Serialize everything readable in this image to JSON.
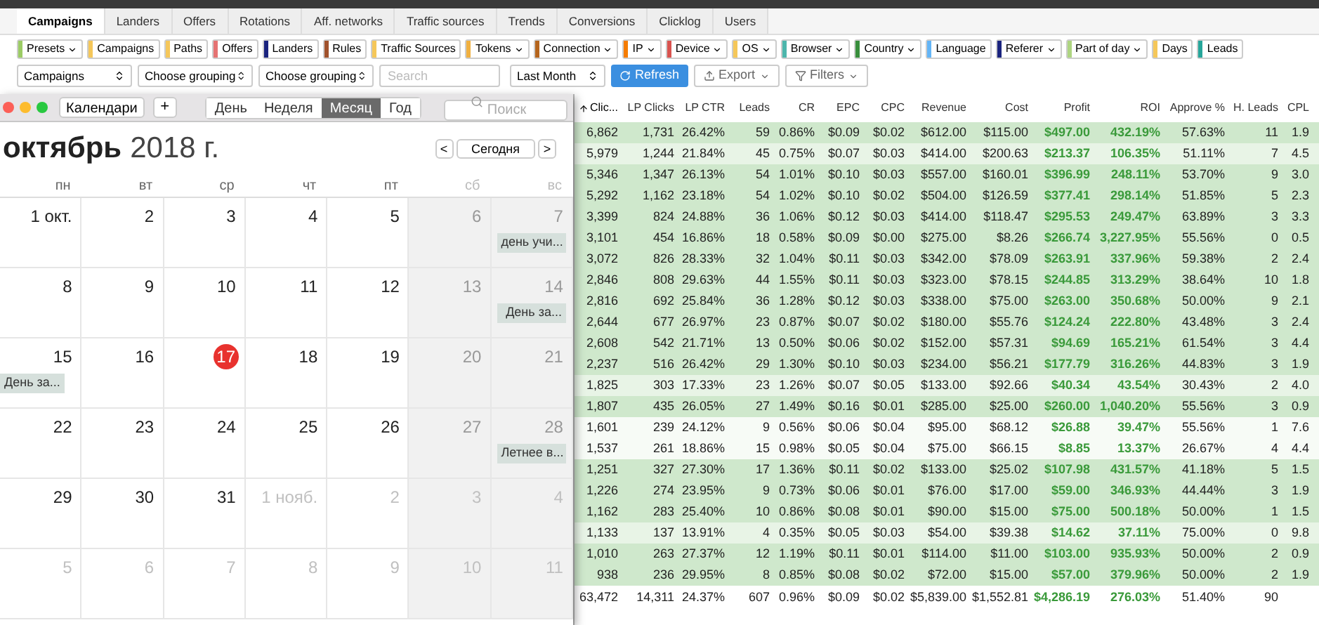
{
  "tabs": [
    {
      "label": "Campaigns",
      "selected": true
    },
    {
      "label": "Landers",
      "selected": false
    },
    {
      "label": "Offers",
      "selected": false
    },
    {
      "label": "Rotations",
      "selected": false
    },
    {
      "label": "Aff. networks",
      "selected": false
    },
    {
      "label": "Traffic sources",
      "selected": false
    },
    {
      "label": "Trends",
      "selected": false
    },
    {
      "label": "Conversions",
      "selected": false
    },
    {
      "label": "Clicklog",
      "selected": false
    },
    {
      "label": "Users",
      "selected": false
    }
  ],
  "report_buttons": [
    {
      "label": "Presets",
      "dropdown": true,
      "color": "#9ccc65"
    },
    {
      "label": "Campaigns",
      "dropdown": false,
      "color": "#f5c75a"
    },
    {
      "label": "Paths",
      "dropdown": false,
      "color": "#f5c75a"
    },
    {
      "label": "Offers",
      "dropdown": false,
      "color": "#e57373"
    },
    {
      "label": "Landers",
      "dropdown": false,
      "color": "#1a237e"
    },
    {
      "label": "Rules",
      "dropdown": false,
      "color": "#a0522d"
    },
    {
      "label": "Traffic Sources",
      "dropdown": false,
      "color": "#f5c75a"
    },
    {
      "label": "Tokens",
      "dropdown": true,
      "color": "#f0b040"
    },
    {
      "label": "Connection",
      "dropdown": true,
      "color": "#b5651d"
    },
    {
      "label": "IP",
      "dropdown": true,
      "color": "#f57c00"
    },
    {
      "label": "Device",
      "dropdown": true,
      "color": "#d9534f"
    },
    {
      "label": "OS",
      "dropdown": true,
      "color": "#f5c75a"
    },
    {
      "label": "Browser",
      "dropdown": true,
      "color": "#4db6ac"
    },
    {
      "label": "Country",
      "dropdown": true,
      "color": "#388e3c"
    },
    {
      "label": "Language",
      "dropdown": false,
      "color": "#64b5f6"
    },
    {
      "label": "Referer",
      "dropdown": true,
      "color": "#1a237e"
    },
    {
      "label": "Part of day",
      "dropdown": true,
      "color": "#aed581"
    },
    {
      "label": "Days",
      "dropdown": false,
      "color": "#f5c75a"
    },
    {
      "label": "Leads",
      "dropdown": false,
      "color": "#26a69a"
    }
  ],
  "filters": {
    "selects": [
      "Campaigns",
      "Choose grouping",
      "Choose grouping"
    ],
    "search": {
      "placeholder": "Search"
    },
    "period": "Last Month",
    "refresh": "Refresh",
    "export": "Export",
    "filters": "Filters"
  },
  "calendar": {
    "calendars_button": "Календари",
    "add_button": "+",
    "views": [
      {
        "label": "День",
        "selected": false
      },
      {
        "label": "Неделя",
        "selected": false
      },
      {
        "label": "Месяц",
        "selected": true
      },
      {
        "label": "Год",
        "selected": false
      }
    ],
    "search": {
      "placeholder": "Поиск"
    },
    "month": "октябрь",
    "year": "2018 г.",
    "prev": "<",
    "today_button": "Сегодня",
    "next": ">",
    "weekdays": [
      {
        "label": "пн",
        "weekend": false
      },
      {
        "label": "вт",
        "weekend": false
      },
      {
        "label": "ср",
        "weekend": false
      },
      {
        "label": "чт",
        "weekend": false
      },
      {
        "label": "пт",
        "weekend": false
      },
      {
        "label": "сб",
        "weekend": true
      },
      {
        "label": "вс",
        "weekend": true
      }
    ],
    "weeks": [
      [
        {
          "label": "1 окт.",
          "muted": false,
          "today": false
        },
        {
          "label": "2",
          "muted": false,
          "today": false
        },
        {
          "label": "3",
          "muted": false,
          "today": false
        },
        {
          "label": "4",
          "muted": false,
          "today": false
        },
        {
          "label": "5",
          "muted": false,
          "today": false
        },
        {
          "label": "6",
          "muted": false,
          "today": false
        },
        {
          "label": "7",
          "muted": false,
          "today": false,
          "events": [
            "день учи..."
          ]
        }
      ],
      [
        {
          "label": "8",
          "muted": false,
          "today": false
        },
        {
          "label": "9",
          "muted": false,
          "today": false
        },
        {
          "label": "10",
          "muted": false,
          "today": false
        },
        {
          "label": "11",
          "muted": false,
          "today": false
        },
        {
          "label": "12",
          "muted": false,
          "today": false
        },
        {
          "label": "13",
          "muted": false,
          "today": false
        },
        {
          "label": "14",
          "muted": false,
          "today": false,
          "events": [
            "День за..."
          ]
        }
      ],
      [
        {
          "label": "15",
          "muted": false,
          "today": false,
          "events": [
            "День за..."
          ]
        },
        {
          "label": "16",
          "muted": false,
          "today": false
        },
        {
          "label": "17",
          "muted": false,
          "today": true
        },
        {
          "label": "18",
          "muted": false,
          "today": false
        },
        {
          "label": "19",
          "muted": false,
          "today": false
        },
        {
          "label": "20",
          "muted": false,
          "today": false
        },
        {
          "label": "21",
          "muted": false,
          "today": false
        }
      ],
      [
        {
          "label": "22",
          "muted": false,
          "today": false
        },
        {
          "label": "23",
          "muted": false,
          "today": false
        },
        {
          "label": "24",
          "muted": false,
          "today": false
        },
        {
          "label": "25",
          "muted": false,
          "today": false
        },
        {
          "label": "26",
          "muted": false,
          "today": false
        },
        {
          "label": "27",
          "muted": false,
          "today": false
        },
        {
          "label": "28",
          "muted": false,
          "today": false,
          "events": [
            "Летнее в..."
          ]
        }
      ],
      [
        {
          "label": "29",
          "muted": false,
          "today": false
        },
        {
          "label": "30",
          "muted": false,
          "today": false
        },
        {
          "label": "31",
          "muted": false,
          "today": false
        },
        {
          "label": "1 нояб.",
          "muted": true,
          "today": false
        },
        {
          "label": "2",
          "muted": true,
          "today": false
        },
        {
          "label": "3",
          "muted": true,
          "today": false
        },
        {
          "label": "4",
          "muted": true,
          "today": false
        }
      ],
      [
        {
          "label": "5",
          "muted": true,
          "today": false
        },
        {
          "label": "6",
          "muted": true,
          "today": false
        },
        {
          "label": "7",
          "muted": true,
          "today": false
        },
        {
          "label": "8",
          "muted": true,
          "today": false
        },
        {
          "label": "9",
          "muted": true,
          "today": false
        },
        {
          "label": "10",
          "muted": true,
          "today": false
        },
        {
          "label": "11",
          "muted": true,
          "today": false
        }
      ]
    ]
  },
  "table": {
    "columns": [
      {
        "label": "Clic...",
        "sorted": true,
        "accent": false
      },
      {
        "label": "LP Clicks",
        "sorted": false,
        "accent": false
      },
      {
        "label": "LP CTR",
        "sorted": false,
        "accent": false
      },
      {
        "label": "Leads",
        "sorted": false,
        "accent": false
      },
      {
        "label": "CR",
        "sorted": false,
        "accent": false
      },
      {
        "label": "EPC",
        "sorted": false,
        "accent": false
      },
      {
        "label": "CPC",
        "sorted": false,
        "accent": false
      },
      {
        "label": "Revenue",
        "sorted": false,
        "accent": false
      },
      {
        "label": "Cost",
        "sorted": false,
        "accent": false
      },
      {
        "label": "Profit",
        "sorted": false,
        "accent": true
      },
      {
        "label": "ROI",
        "sorted": false,
        "accent": true
      },
      {
        "label": "Approve %",
        "sorted": false,
        "accent": false
      },
      {
        "label": "H. Leads",
        "sorted": false,
        "accent": false
      },
      {
        "label": "CPL",
        "sorted": false,
        "accent": false
      }
    ],
    "rows": [
      {
        "color": "#cfe8cc",
        "cells": [
          "6,862",
          "1,731",
          "26.42%",
          "59",
          "0.86%",
          "$0.09",
          "$0.02",
          "$612.00",
          "$115.00",
          "$497.00",
          "432.19%",
          "57.63%",
          "11",
          "1.9"
        ]
      },
      {
        "color": "#e8f4e6",
        "cells": [
          "5,979",
          "1,244",
          "21.84%",
          "45",
          "0.75%",
          "$0.07",
          "$0.03",
          "$414.00",
          "$200.63",
          "$213.37",
          "106.35%",
          "51.11%",
          "7",
          "4.5"
        ]
      },
      {
        "color": "#cfe8cc",
        "cells": [
          "5,346",
          "1,347",
          "26.13%",
          "54",
          "1.01%",
          "$0.10",
          "$0.03",
          "$557.00",
          "$160.01",
          "$396.99",
          "248.11%",
          "53.70%",
          "9",
          "3.0"
        ]
      },
      {
        "color": "#cfe8cc",
        "cells": [
          "5,292",
          "1,162",
          "23.18%",
          "54",
          "1.02%",
          "$0.10",
          "$0.02",
          "$504.00",
          "$126.59",
          "$377.41",
          "298.14%",
          "51.85%",
          "5",
          "2.3"
        ]
      },
      {
        "color": "#cfe8cc",
        "cells": [
          "3,399",
          "824",
          "24.88%",
          "36",
          "1.06%",
          "$0.12",
          "$0.03",
          "$414.00",
          "$118.47",
          "$295.53",
          "249.47%",
          "63.89%",
          "3",
          "3.3"
        ]
      },
      {
        "color": "#cfe8cc",
        "cells": [
          "3,101",
          "454",
          "16.86%",
          "18",
          "0.58%",
          "$0.09",
          "$0.00",
          "$275.00",
          "$8.26",
          "$266.74",
          "3,227.95%",
          "55.56%",
          "0",
          "0.5"
        ]
      },
      {
        "color": "#cfe8cc",
        "cells": [
          "3,072",
          "826",
          "28.33%",
          "32",
          "1.04%",
          "$0.11",
          "$0.03",
          "$342.00",
          "$78.09",
          "$263.91",
          "337.96%",
          "59.38%",
          "2",
          "2.4"
        ]
      },
      {
        "color": "#cfe8cc",
        "cells": [
          "2,846",
          "808",
          "29.63%",
          "44",
          "1.55%",
          "$0.11",
          "$0.03",
          "$323.00",
          "$78.15",
          "$244.85",
          "313.29%",
          "38.64%",
          "10",
          "1.8"
        ]
      },
      {
        "color": "#cfe8cc",
        "cells": [
          "2,816",
          "692",
          "25.84%",
          "36",
          "1.28%",
          "$0.12",
          "$0.03",
          "$338.00",
          "$75.00",
          "$263.00",
          "350.68%",
          "50.00%",
          "9",
          "2.1"
        ]
      },
      {
        "color": "#cfe8cc",
        "cells": [
          "2,644",
          "677",
          "26.97%",
          "23",
          "0.87%",
          "$0.07",
          "$0.02",
          "$180.00",
          "$55.76",
          "$124.24",
          "222.80%",
          "43.48%",
          "3",
          "2.4"
        ]
      },
      {
        "color": "#cfe8cc",
        "cells": [
          "2,608",
          "542",
          "21.71%",
          "13",
          "0.50%",
          "$0.06",
          "$0.02",
          "$152.00",
          "$57.31",
          "$94.69",
          "165.21%",
          "61.54%",
          "3",
          "4.4"
        ]
      },
      {
        "color": "#cfe8cc",
        "cells": [
          "2,237",
          "516",
          "26.42%",
          "29",
          "1.30%",
          "$0.10",
          "$0.03",
          "$234.00",
          "$56.21",
          "$177.79",
          "316.26%",
          "44.83%",
          "3",
          "1.9"
        ]
      },
      {
        "color": "#e8f4e6",
        "cells": [
          "1,825",
          "303",
          "17.33%",
          "23",
          "1.26%",
          "$0.07",
          "$0.05",
          "$133.00",
          "$92.66",
          "$40.34",
          "43.54%",
          "30.43%",
          "2",
          "4.0"
        ]
      },
      {
        "color": "#cfe8cc",
        "cells": [
          "1,807",
          "435",
          "26.05%",
          "27",
          "1.49%",
          "$0.16",
          "$0.01",
          "$285.00",
          "$25.00",
          "$260.00",
          "1,040.20%",
          "55.56%",
          "3",
          "0.9"
        ]
      },
      {
        "color": "#f7fbf6",
        "cells": [
          "1,601",
          "239",
          "24.12%",
          "9",
          "0.56%",
          "$0.06",
          "$0.04",
          "$95.00",
          "$68.12",
          "$26.88",
          "39.47%",
          "55.56%",
          "1",
          "7.6"
        ]
      },
      {
        "color": "#f7fbf6",
        "cells": [
          "1,537",
          "261",
          "18.86%",
          "15",
          "0.98%",
          "$0.05",
          "$0.04",
          "$75.00",
          "$66.15",
          "$8.85",
          "13.37%",
          "26.67%",
          "4",
          "4.4"
        ]
      },
      {
        "color": "#cfe8cc",
        "cells": [
          "1,251",
          "327",
          "27.30%",
          "17",
          "1.36%",
          "$0.11",
          "$0.02",
          "$133.00",
          "$25.02",
          "$107.98",
          "431.57%",
          "41.18%",
          "5",
          "1.5"
        ]
      },
      {
        "color": "#cfe8cc",
        "cells": [
          "1,226",
          "274",
          "23.95%",
          "9",
          "0.73%",
          "$0.06",
          "$0.01",
          "$76.00",
          "$17.00",
          "$59.00",
          "346.93%",
          "44.44%",
          "3",
          "1.9"
        ]
      },
      {
        "color": "#cfe8cc",
        "cells": [
          "1,162",
          "283",
          "25.40%",
          "10",
          "0.86%",
          "$0.08",
          "$0.01",
          "$90.00",
          "$15.00",
          "$75.00",
          "500.18%",
          "50.00%",
          "1",
          "1.5"
        ]
      },
      {
        "color": "#e8f4e6",
        "cells": [
          "1,133",
          "137",
          "13.91%",
          "4",
          "0.35%",
          "$0.05",
          "$0.03",
          "$54.00",
          "$39.38",
          "$14.62",
          "37.11%",
          "75.00%",
          "0",
          "9.8"
        ]
      },
      {
        "color": "#cfe8cc",
        "cells": [
          "1,010",
          "263",
          "27.37%",
          "12",
          "1.19%",
          "$0.11",
          "$0.01",
          "$114.00",
          "$11.00",
          "$103.00",
          "935.93%",
          "50.00%",
          "2",
          "0.9"
        ]
      },
      {
        "color": "#cfe8cc",
        "cells": [
          "938",
          "236",
          "29.95%",
          "8",
          "0.85%",
          "$0.08",
          "$0.02",
          "$72.00",
          "$15.00",
          "$57.00",
          "379.96%",
          "50.00%",
          "2",
          "1.9"
        ]
      }
    ],
    "totals": [
      "63,472",
      "14,311",
      "24.37%",
      "607",
      "0.96%",
      "$0.09",
      "$0.02",
      "$5,839.00",
      "$1,552.81",
      "$4,286.19",
      "276.03%",
      "51.40%",
      "90"
    ]
  }
}
